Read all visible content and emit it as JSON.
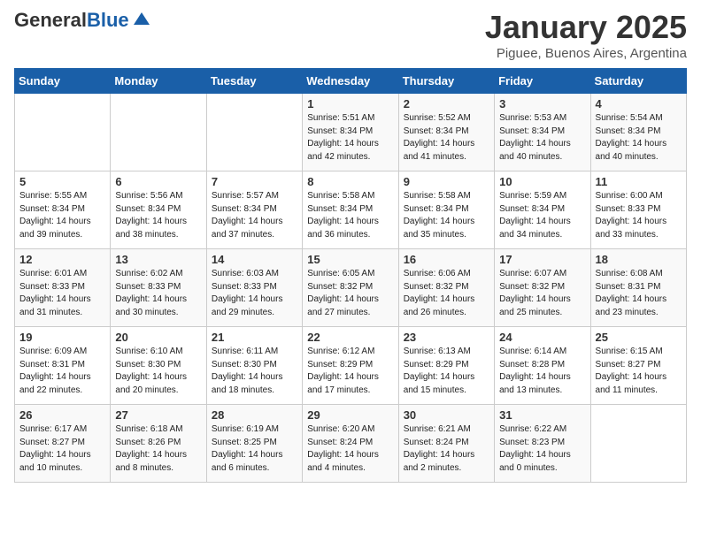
{
  "header": {
    "logo_general": "General",
    "logo_blue": "Blue",
    "month_title": "January 2025",
    "subtitle": "Piguee, Buenos Aires, Argentina"
  },
  "days_of_week": [
    "Sunday",
    "Monday",
    "Tuesday",
    "Wednesday",
    "Thursday",
    "Friday",
    "Saturday"
  ],
  "weeks": [
    [
      {
        "day": "",
        "info": ""
      },
      {
        "day": "",
        "info": ""
      },
      {
        "day": "",
        "info": ""
      },
      {
        "day": "1",
        "info": "Sunrise: 5:51 AM\nSunset: 8:34 PM\nDaylight: 14 hours\nand 42 minutes."
      },
      {
        "day": "2",
        "info": "Sunrise: 5:52 AM\nSunset: 8:34 PM\nDaylight: 14 hours\nand 41 minutes."
      },
      {
        "day": "3",
        "info": "Sunrise: 5:53 AM\nSunset: 8:34 PM\nDaylight: 14 hours\nand 40 minutes."
      },
      {
        "day": "4",
        "info": "Sunrise: 5:54 AM\nSunset: 8:34 PM\nDaylight: 14 hours\nand 40 minutes."
      }
    ],
    [
      {
        "day": "5",
        "info": "Sunrise: 5:55 AM\nSunset: 8:34 PM\nDaylight: 14 hours\nand 39 minutes."
      },
      {
        "day": "6",
        "info": "Sunrise: 5:56 AM\nSunset: 8:34 PM\nDaylight: 14 hours\nand 38 minutes."
      },
      {
        "day": "7",
        "info": "Sunrise: 5:57 AM\nSunset: 8:34 PM\nDaylight: 14 hours\nand 37 minutes."
      },
      {
        "day": "8",
        "info": "Sunrise: 5:58 AM\nSunset: 8:34 PM\nDaylight: 14 hours\nand 36 minutes."
      },
      {
        "day": "9",
        "info": "Sunrise: 5:58 AM\nSunset: 8:34 PM\nDaylight: 14 hours\nand 35 minutes."
      },
      {
        "day": "10",
        "info": "Sunrise: 5:59 AM\nSunset: 8:34 PM\nDaylight: 14 hours\nand 34 minutes."
      },
      {
        "day": "11",
        "info": "Sunrise: 6:00 AM\nSunset: 8:33 PM\nDaylight: 14 hours\nand 33 minutes."
      }
    ],
    [
      {
        "day": "12",
        "info": "Sunrise: 6:01 AM\nSunset: 8:33 PM\nDaylight: 14 hours\nand 31 minutes."
      },
      {
        "day": "13",
        "info": "Sunrise: 6:02 AM\nSunset: 8:33 PM\nDaylight: 14 hours\nand 30 minutes."
      },
      {
        "day": "14",
        "info": "Sunrise: 6:03 AM\nSunset: 8:33 PM\nDaylight: 14 hours\nand 29 minutes."
      },
      {
        "day": "15",
        "info": "Sunrise: 6:05 AM\nSunset: 8:32 PM\nDaylight: 14 hours\nand 27 minutes."
      },
      {
        "day": "16",
        "info": "Sunrise: 6:06 AM\nSunset: 8:32 PM\nDaylight: 14 hours\nand 26 minutes."
      },
      {
        "day": "17",
        "info": "Sunrise: 6:07 AM\nSunset: 8:32 PM\nDaylight: 14 hours\nand 25 minutes."
      },
      {
        "day": "18",
        "info": "Sunrise: 6:08 AM\nSunset: 8:31 PM\nDaylight: 14 hours\nand 23 minutes."
      }
    ],
    [
      {
        "day": "19",
        "info": "Sunrise: 6:09 AM\nSunset: 8:31 PM\nDaylight: 14 hours\nand 22 minutes."
      },
      {
        "day": "20",
        "info": "Sunrise: 6:10 AM\nSunset: 8:30 PM\nDaylight: 14 hours\nand 20 minutes."
      },
      {
        "day": "21",
        "info": "Sunrise: 6:11 AM\nSunset: 8:30 PM\nDaylight: 14 hours\nand 18 minutes."
      },
      {
        "day": "22",
        "info": "Sunrise: 6:12 AM\nSunset: 8:29 PM\nDaylight: 14 hours\nand 17 minutes."
      },
      {
        "day": "23",
        "info": "Sunrise: 6:13 AM\nSunset: 8:29 PM\nDaylight: 14 hours\nand 15 minutes."
      },
      {
        "day": "24",
        "info": "Sunrise: 6:14 AM\nSunset: 8:28 PM\nDaylight: 14 hours\nand 13 minutes."
      },
      {
        "day": "25",
        "info": "Sunrise: 6:15 AM\nSunset: 8:27 PM\nDaylight: 14 hours\nand 11 minutes."
      }
    ],
    [
      {
        "day": "26",
        "info": "Sunrise: 6:17 AM\nSunset: 8:27 PM\nDaylight: 14 hours\nand 10 minutes."
      },
      {
        "day": "27",
        "info": "Sunrise: 6:18 AM\nSunset: 8:26 PM\nDaylight: 14 hours\nand 8 minutes."
      },
      {
        "day": "28",
        "info": "Sunrise: 6:19 AM\nSunset: 8:25 PM\nDaylight: 14 hours\nand 6 minutes."
      },
      {
        "day": "29",
        "info": "Sunrise: 6:20 AM\nSunset: 8:24 PM\nDaylight: 14 hours\nand 4 minutes."
      },
      {
        "day": "30",
        "info": "Sunrise: 6:21 AM\nSunset: 8:24 PM\nDaylight: 14 hours\nand 2 minutes."
      },
      {
        "day": "31",
        "info": "Sunrise: 6:22 AM\nSunset: 8:23 PM\nDaylight: 14 hours\nand 0 minutes."
      },
      {
        "day": "",
        "info": ""
      }
    ]
  ]
}
